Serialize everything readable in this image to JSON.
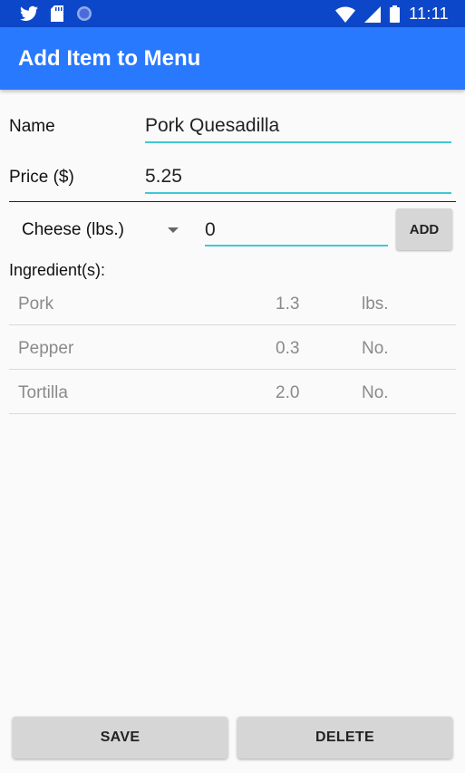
{
  "status_bar": {
    "time": "11:11",
    "left_icons": [
      "twitter-icon",
      "sd-card-icon",
      "sync-circle-icon"
    ],
    "right_icons": [
      "wifi-icon",
      "signal-icon",
      "battery-icon"
    ]
  },
  "app_bar": {
    "title": "Add Item to Menu"
  },
  "form": {
    "name_label": "Name",
    "name_value": "Pork Quesadilla",
    "price_label": "Price ($)",
    "price_value": "5.25"
  },
  "ingredient_picker": {
    "selected": "Cheese (lbs.)",
    "quantity_value": "0",
    "add_label": "ADD"
  },
  "ingredients": {
    "title": "Ingredient(s):",
    "rows": [
      {
        "name": "Pork",
        "qty": "1.3",
        "unit": "lbs."
      },
      {
        "name": "Pepper",
        "qty": "0.3",
        "unit": "No."
      },
      {
        "name": "Tortilla",
        "qty": "2.0",
        "unit": "No."
      }
    ]
  },
  "actions": {
    "save_label": "SAVE",
    "delete_label": "DELETE"
  },
  "colors": {
    "status_bar": "#0d47c9",
    "app_bar": "#2979ff",
    "field_underline": "#3fc9d5",
    "button_bg": "#d6d6d6"
  }
}
